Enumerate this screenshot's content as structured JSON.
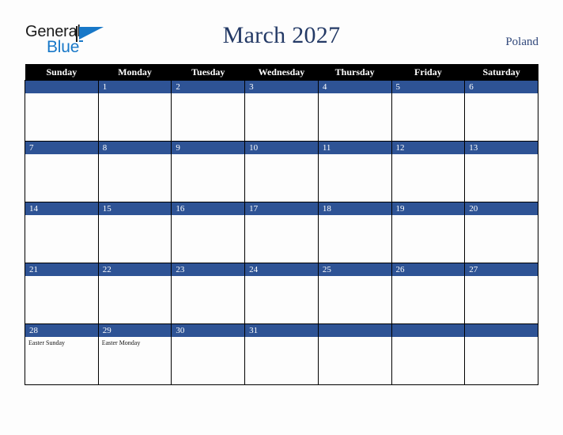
{
  "brand": {
    "name_part1": "General",
    "name_part2": "Blue",
    "mark_icon": "triangle-logo-icon"
  },
  "header": {
    "title": "March 2027",
    "country": "Poland"
  },
  "colors": {
    "accent_blue": "#2e5395",
    "header_black": "#000000",
    "title_navy": "#243a66",
    "logo_blue": "#1878c8",
    "page_background": "#fdfdfd"
  },
  "calendar": {
    "weekday_headers": [
      "Sunday",
      "Monday",
      "Tuesday",
      "Wednesday",
      "Thursday",
      "Friday",
      "Saturday"
    ],
    "weeks": [
      [
        {
          "num": "",
          "events": []
        },
        {
          "num": "1",
          "events": []
        },
        {
          "num": "2",
          "events": []
        },
        {
          "num": "3",
          "events": []
        },
        {
          "num": "4",
          "events": []
        },
        {
          "num": "5",
          "events": []
        },
        {
          "num": "6",
          "events": []
        }
      ],
      [
        {
          "num": "7",
          "events": []
        },
        {
          "num": "8",
          "events": []
        },
        {
          "num": "9",
          "events": []
        },
        {
          "num": "10",
          "events": []
        },
        {
          "num": "11",
          "events": []
        },
        {
          "num": "12",
          "events": []
        },
        {
          "num": "13",
          "events": []
        }
      ],
      [
        {
          "num": "14",
          "events": []
        },
        {
          "num": "15",
          "events": []
        },
        {
          "num": "16",
          "events": []
        },
        {
          "num": "17",
          "events": []
        },
        {
          "num": "18",
          "events": []
        },
        {
          "num": "19",
          "events": []
        },
        {
          "num": "20",
          "events": []
        }
      ],
      [
        {
          "num": "21",
          "events": []
        },
        {
          "num": "22",
          "events": []
        },
        {
          "num": "23",
          "events": []
        },
        {
          "num": "24",
          "events": []
        },
        {
          "num": "25",
          "events": []
        },
        {
          "num": "26",
          "events": []
        },
        {
          "num": "27",
          "events": []
        }
      ],
      [
        {
          "num": "28",
          "events": [
            "Easter Sunday"
          ]
        },
        {
          "num": "29",
          "events": [
            "Easter Monday"
          ]
        },
        {
          "num": "30",
          "events": []
        },
        {
          "num": "31",
          "events": []
        },
        {
          "num": "",
          "events": []
        },
        {
          "num": "",
          "events": []
        },
        {
          "num": "",
          "events": []
        }
      ]
    ]
  }
}
